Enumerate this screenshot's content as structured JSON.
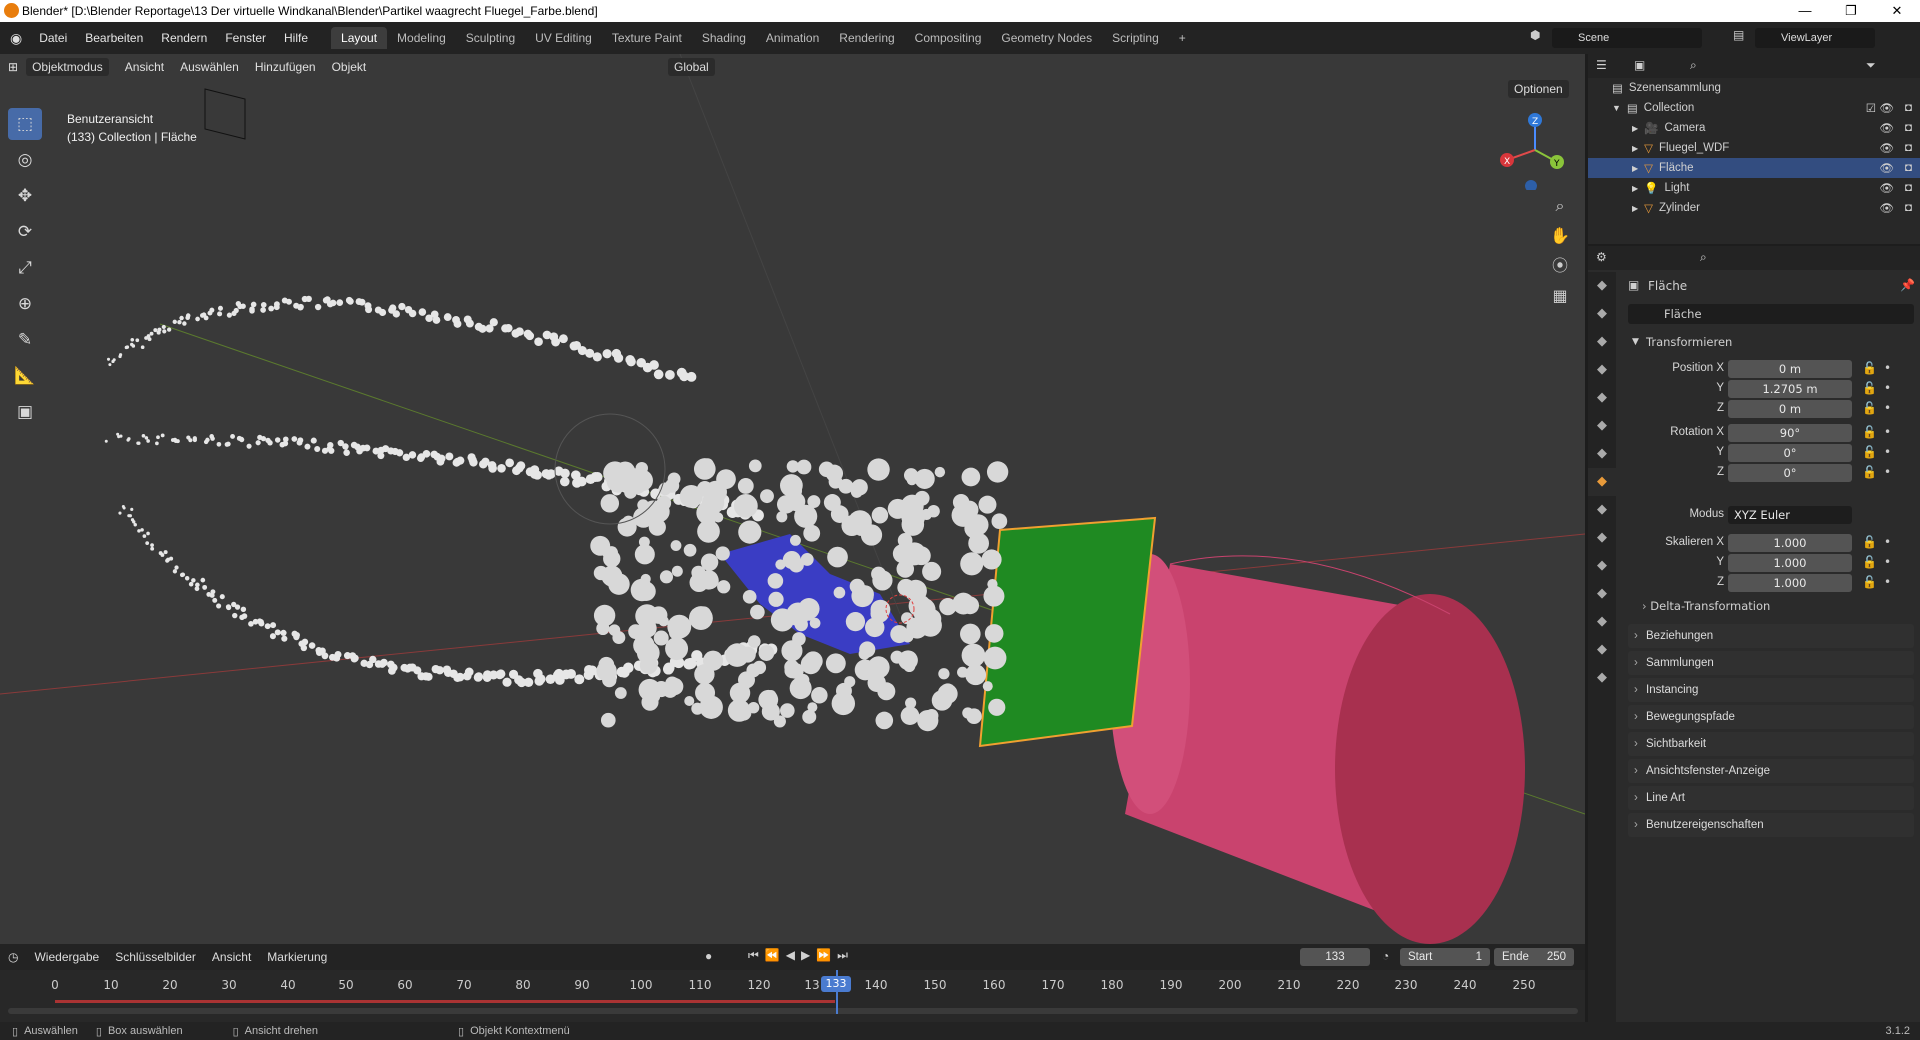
{
  "window": {
    "title": "Blender* [D:\\Blender Reportage\\13 Der virtuelle Windkanal\\Blender\\Partikel waagrecht Fluegel_Farbe.blend]",
    "minimize": "—",
    "restore": "❐",
    "close": "✕"
  },
  "menu": [
    "Datei",
    "Bearbeiten",
    "Rendern",
    "Fenster",
    "Hilfe"
  ],
  "workspaces": [
    "Layout",
    "Modeling",
    "Sculpting",
    "UV Editing",
    "Texture Paint",
    "Shading",
    "Animation",
    "Rendering",
    "Compositing",
    "Geometry Nodes",
    "Scripting",
    "+"
  ],
  "active_workspace": "Layout",
  "scene": "Scene",
  "view_layer": "ViewLayer",
  "viewport": {
    "mode": "Objektmodus",
    "menus": [
      "Ansicht",
      "Auswählen",
      "Hinzufügen",
      "Objekt"
    ],
    "orientation": "Global",
    "options": "Optionen",
    "info_line1": "Benutzeransicht",
    "info_line2": "(133) Collection | Fläche",
    "gizmo": {
      "x": "X",
      "y": "Y",
      "z": "Z"
    }
  },
  "tools": [
    "select-box",
    "cursor",
    "move",
    "rotate",
    "scale",
    "transform",
    "annotate",
    "measure",
    "add-cube"
  ],
  "outliner": {
    "root": "Szenensammlung",
    "collection": "Collection",
    "items": [
      {
        "name": "Camera",
        "selected": false
      },
      {
        "name": "Fluegel_WDF",
        "selected": false
      },
      {
        "name": "Fläche",
        "selected": true
      },
      {
        "name": "Light",
        "selected": false
      },
      {
        "name": "Zylinder",
        "selected": false
      }
    ]
  },
  "properties": {
    "object_name": "Fläche",
    "object_field": "Fläche",
    "transform_header": "Transformieren",
    "position_label": "Position X",
    "rotation_label": "Rotation X",
    "scale_label": "Skalieren X",
    "y_label": "Y",
    "z_label": "Z",
    "position": [
      "0 m",
      "1.2705 m",
      "0 m"
    ],
    "rotation": [
      "90°",
      "0°",
      "0°"
    ],
    "mode_label": "Modus",
    "mode_value": "XYZ Euler",
    "scale": [
      "1.000",
      "1.000",
      "1.000"
    ],
    "delta": "Delta-Transformation",
    "panels": [
      "Beziehungen",
      "Sammlungen",
      "Instancing",
      "Bewegungspfade",
      "Sichtbarkeit",
      "Ansichtsfenster-Anzeige",
      "Line Art",
      "Benutzereigenschaften"
    ]
  },
  "timeline": {
    "menus": [
      "Wiedergabe",
      "Schlüsselbilder",
      "Ansicht",
      "Markierung"
    ],
    "current_frame": "133",
    "start_label": "Start",
    "start": "1",
    "end_label": "Ende",
    "end": "250",
    "ticks": [
      "0",
      "10",
      "20",
      "30",
      "40",
      "50",
      "60",
      "70",
      "80",
      "90",
      "100",
      "110",
      "120",
      "13",
      "140",
      "150",
      "160",
      "170",
      "180",
      "190",
      "200",
      "210",
      "220",
      "230",
      "240",
      "250"
    ],
    "playhead_label": "133"
  },
  "status": {
    "select": "Auswählen",
    "box": "Box auswählen",
    "rotate": "Ansicht drehen",
    "context": "Objekt Kontextmenü",
    "version": "3.1.2"
  },
  "colors": {
    "accent": "#476ba8",
    "selected_row": "#334d80",
    "plane": "#1f8a22",
    "cylinder": "#c9436e",
    "wing": "#3a3dc4",
    "playhead": "#4a7bd0"
  }
}
